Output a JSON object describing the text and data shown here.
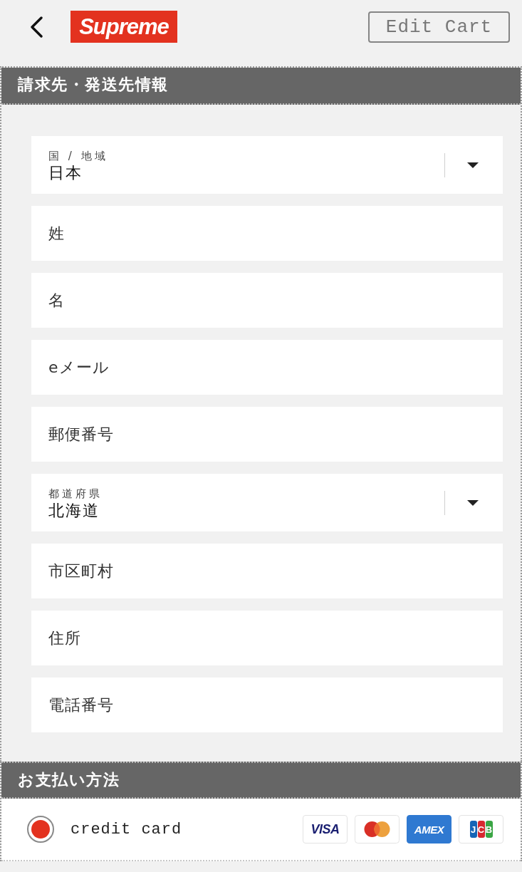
{
  "header": {
    "logo": "Supreme",
    "edit_button": "Edit Cart"
  },
  "billing": {
    "title": "請求先・発送先情報",
    "fields": [
      {
        "kind": "select",
        "label": "国 / 地域",
        "value": "日本"
      },
      {
        "kind": "text",
        "placeholder": "姓"
      },
      {
        "kind": "text",
        "placeholder": "名"
      },
      {
        "kind": "text",
        "placeholder": "eメール"
      },
      {
        "kind": "text",
        "placeholder": "郵便番号"
      },
      {
        "kind": "select",
        "label": "都道府県",
        "value": "北海道"
      },
      {
        "kind": "text",
        "placeholder": "市区町村"
      },
      {
        "kind": "text",
        "placeholder": "住所"
      },
      {
        "kind": "text",
        "placeholder": "電話番号"
      }
    ]
  },
  "payment": {
    "title": "お支払い方法",
    "methods": [
      {
        "label": "credit card",
        "selected": true,
        "cards": [
          {
            "kind": "visa",
            "text": "VISA"
          },
          {
            "kind": "mastercard"
          },
          {
            "kind": "amex",
            "text": "AMEX"
          },
          {
            "kind": "jcb",
            "text": "JCB"
          }
        ]
      }
    ]
  }
}
